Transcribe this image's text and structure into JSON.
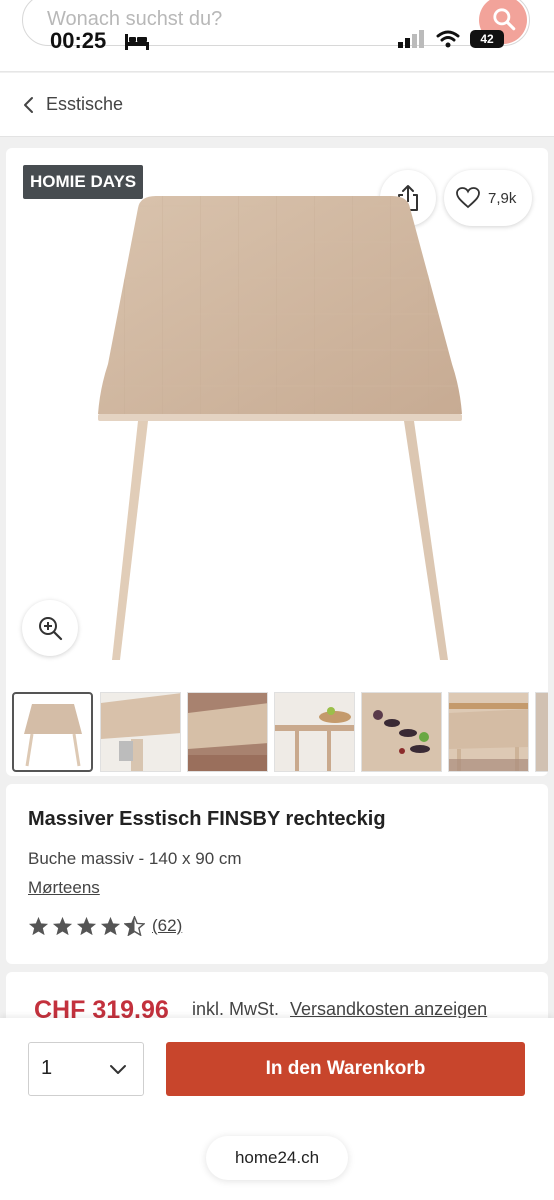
{
  "search": {
    "placeholder": "Wonach suchst du?"
  },
  "status": {
    "time": "00:25",
    "battery": "42"
  },
  "breadcrumb": {
    "label": "Esstische"
  },
  "gallery": {
    "badge": "HOMIE DAYS",
    "wishlist_count": "7,9k",
    "thumbnail_count": 7,
    "active_thumbnail": 1
  },
  "product": {
    "title": "Massiver Esstisch FINSBY rechteckig",
    "subtitle": "Buche massiv - 140 x 90 cm",
    "brand": "Mørteens",
    "rating": 4.5,
    "rating_count": "(62)"
  },
  "price": {
    "amount": "CHF 319.96",
    "note": "inkl. MwSt.",
    "shipping_link": "Versandkosten anzeigen"
  },
  "cart": {
    "quantity": "1",
    "button_label": "In den Warenkorb"
  },
  "browser": {
    "url": "home24.ch"
  },
  "colors": {
    "accent": "#c8452c",
    "price": "#c3313d",
    "badge": "#474c50"
  }
}
